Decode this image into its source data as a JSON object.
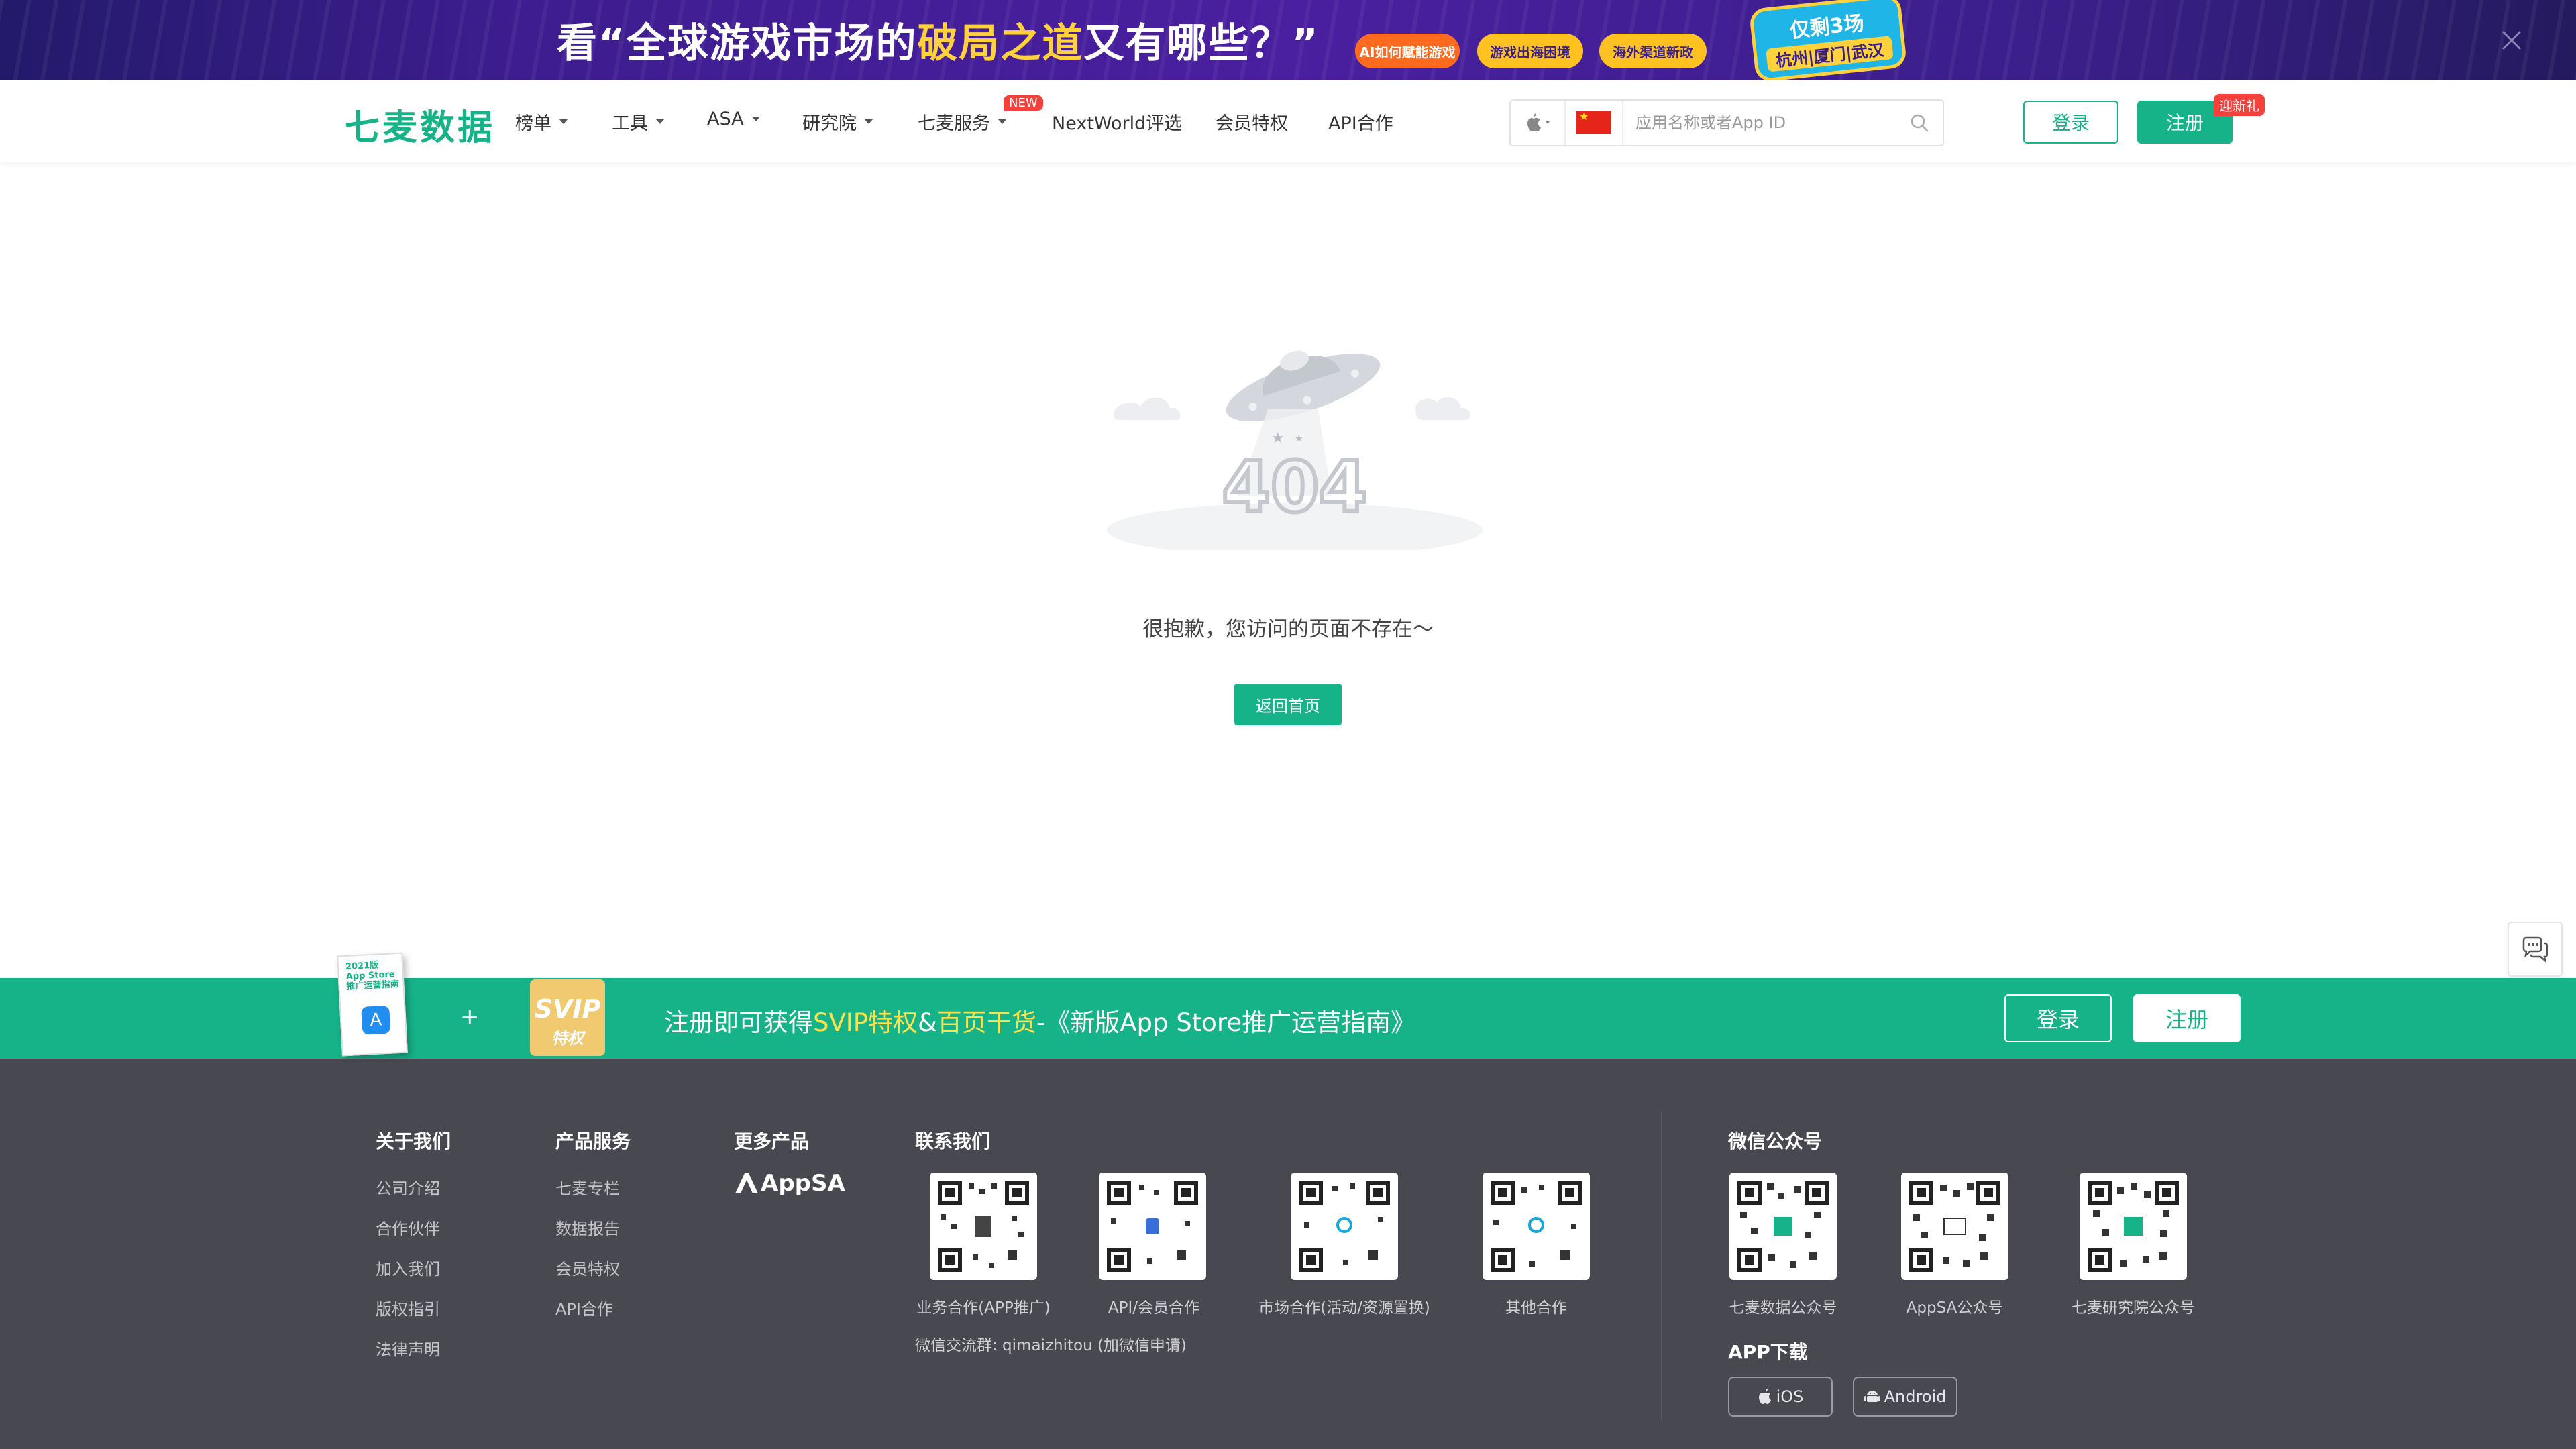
{
  "banner": {
    "headline_pre": "看“全球游戏市场的",
    "headline_hl": "破局之道",
    "headline_post": "又有哪些？”",
    "pills": [
      "AI如何赋能游戏",
      "游戏出海困境",
      "海外渠道新政"
    ],
    "badge_top": "仅剩3场",
    "badge_bottom": "杭州|厦门|武汉",
    "colors": {
      "bg": "#3d1d8f",
      "highlight": "#ffd23c"
    }
  },
  "nav": {
    "logo": "七麦数据",
    "items": [
      "榜单",
      "工具",
      "ASA",
      "研究院",
      "七麦服务",
      "NextWorld评选",
      "会员特权",
      "API合作"
    ],
    "new_badge": "NEW",
    "search_placeholder": "应用名称或者App ID",
    "login": "登录",
    "register": "注册",
    "register_badge": "迎新礼",
    "accent": "#16b388"
  },
  "main": {
    "error_code": "404",
    "message": "很抱歉，您访问的页面不存在～",
    "home_button": "返回首页"
  },
  "promo": {
    "plus": "+",
    "svip_label": "SVIP",
    "svip_sub": "特权",
    "text_pre": "注册即可获得",
    "text_svip": "SVIP特权",
    "text_amp": "&",
    "text_gift": "百页干货",
    "text_post": "-《新版App Store推广运营指南》",
    "login": "登录",
    "register": "注册",
    "book_title": "2021版 App Store推广运营指南"
  },
  "footer": {
    "about": {
      "title": "关于我们",
      "links": [
        "公司介绍",
        "合作伙伴",
        "加入我们",
        "版权指引",
        "法律声明"
      ]
    },
    "products": {
      "title": "产品服务",
      "links": [
        "七麦专栏",
        "数据报告",
        "会员特权",
        "API合作"
      ]
    },
    "more": {
      "title": "更多产品",
      "appsa": "AppSA"
    },
    "contact": {
      "title": "联系我们",
      "qrs": [
        "业务合作(APP推广)",
        "API/会员合作",
        "市场合作(活动/资源置换)",
        "其他合作"
      ],
      "wechat_group": "微信交流群: qimaizhitou (加微信申请)"
    },
    "wechat": {
      "title": "微信公众号",
      "qrs": [
        "七麦数据公众号",
        "AppSA公众号",
        "七麦研究院公众号"
      ]
    },
    "app_download": {
      "title": "APP下载",
      "ios": "iOS",
      "android": "Android"
    }
  }
}
